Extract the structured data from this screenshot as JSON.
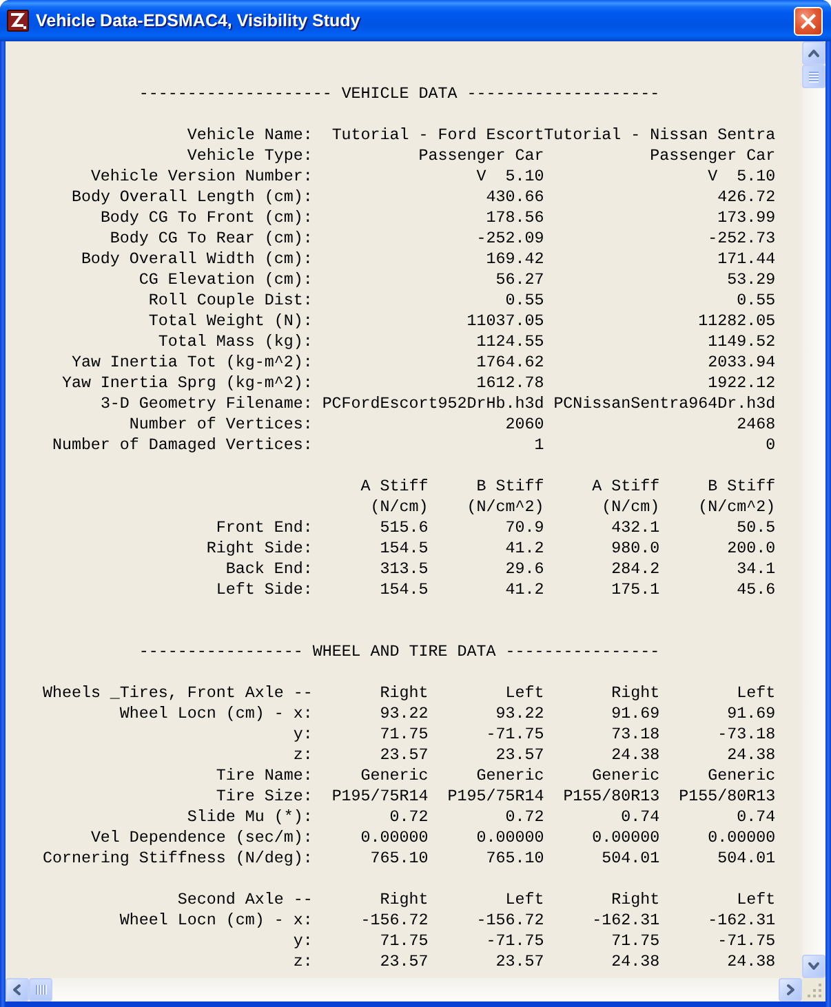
{
  "window": {
    "title": "Vehicle Data-EDSMAC4, Visibility Study"
  },
  "report": {
    "sections": [
      {
        "heading": "-------------------- VEHICLE DATA --------------------",
        "blocks": [
          {
            "kind": "pairs",
            "rows": [
              {
                "label": "Vehicle Name:",
                "values": [
                  "Tutorial - Ford Escort",
                  "Tutorial - Nissan Sentra"
                ]
              },
              {
                "label": "Vehicle Type:",
                "values": [
                  "Passenger Car",
                  "Passenger Car"
                ]
              },
              {
                "label": "Vehicle Version Number:",
                "values": [
                  "V  5.10",
                  "V  5.10"
                ]
              },
              {
                "label": "Body Overall Length (cm):",
                "values": [
                  "430.66",
                  "426.72"
                ]
              },
              {
                "label": "Body CG To Front (cm):",
                "values": [
                  "178.56",
                  "173.99"
                ]
              },
              {
                "label": "Body CG To Rear (cm):",
                "values": [
                  "-252.09",
                  "-252.73"
                ]
              },
              {
                "label": "Body Overall Width (cm):",
                "values": [
                  "169.42",
                  "171.44"
                ]
              },
              {
                "label": "CG Elevation (cm):",
                "values": [
                  "56.27",
                  "53.29"
                ]
              },
              {
                "label": "Roll Couple Dist:",
                "values": [
                  "0.55",
                  "0.55"
                ]
              },
              {
                "label": "Total Weight (N):",
                "values": [
                  "11037.05",
                  "11282.05"
                ]
              },
              {
                "label": "Total Mass (kg):",
                "values": [
                  "1124.55",
                  "1149.52"
                ]
              },
              {
                "label": "Yaw Inertia Tot (kg-m^2):",
                "values": [
                  "1764.62",
                  "2033.94"
                ]
              },
              {
                "label": "Yaw Inertia Sprg (kg-m^2):",
                "values": [
                  "1612.78",
                  "1922.12"
                ]
              },
              {
                "label": "3-D Geometry Filename:",
                "values": [
                  "PCFordEscort952DrHb.h3d",
                  "PCNissanSentra964Dr.h3d"
                ]
              },
              {
                "label": "Number of Vertices:",
                "values": [
                  "2060",
                  "2468"
                ]
              },
              {
                "label": "Number of Damaged Vertices:",
                "values": [
                  "1",
                  "0"
                ]
              }
            ]
          },
          {
            "kind": "table",
            "columns": [
              {
                "title": "A Stiff",
                "unit": "(N/cm)"
              },
              {
                "title": "B Stiff",
                "unit": "(N/cm^2)"
              },
              {
                "title": "A Stiff",
                "unit": "(N/cm)"
              },
              {
                "title": "B Stiff",
                "unit": "(N/cm^2)"
              }
            ],
            "rows": [
              {
                "label": "Front End:",
                "values": [
                  "515.6",
                  "70.9",
                  "432.1",
                  "50.5"
                ]
              },
              {
                "label": "Right Side:",
                "values": [
                  "154.5",
                  "41.2",
                  "980.0",
                  "200.0"
                ]
              },
              {
                "label": "Back End:",
                "values": [
                  "313.5",
                  "29.6",
                  "284.2",
                  "34.1"
                ]
              },
              {
                "label": "Left Side:",
                "values": [
                  "154.5",
                  "41.2",
                  "175.1",
                  "45.6"
                ]
              }
            ]
          }
        ]
      },
      {
        "heading": "----------------- WHEEL AND TIRE DATA ----------------",
        "blocks": [
          {
            "kind": "table",
            "axle_header": {
              "label": "Wheels _Tires, Front Axle --",
              "values": [
                "Right",
                "Left",
                "Right",
                "Left"
              ]
            },
            "rows": [
              {
                "label": "Wheel Locn (cm) - x:",
                "values": [
                  "93.22",
                  "93.22",
                  "91.69",
                  "91.69"
                ]
              },
              {
                "label": "y:",
                "values": [
                  "71.75",
                  "-71.75",
                  "73.18",
                  "-73.18"
                ]
              },
              {
                "label": "z:",
                "values": [
                  "23.57",
                  "23.57",
                  "24.38",
                  "24.38"
                ]
              },
              {
                "label": "Tire Name:",
                "values": [
                  "Generic",
                  "Generic",
                  "Generic",
                  "Generic"
                ]
              },
              {
                "label": "Tire Size:",
                "values": [
                  "P195/75R14",
                  "P195/75R14",
                  "P155/80R13",
                  "P155/80R13"
                ]
              },
              {
                "label": "Slide Mu (*):",
                "values": [
                  "0.72",
                  "0.72",
                  "0.74",
                  "0.74"
                ]
              },
              {
                "label": "Vel Dependence (sec/m):",
                "values": [
                  "0.00000",
                  "0.00000",
                  "0.00000",
                  "0.00000"
                ]
              },
              {
                "label": "Cornering Stiffness (N/deg):",
                "values": [
                  "765.10",
                  "765.10",
                  "504.01",
                  "504.01"
                ]
              }
            ]
          },
          {
            "kind": "table",
            "axle_header": {
              "label": "Second Axle --",
              "values": [
                "Right",
                "Left",
                "Right",
                "Left"
              ]
            },
            "rows": [
              {
                "label": "Wheel Locn (cm) - x:",
                "values": [
                  "-156.72",
                  "-156.72",
                  "-162.31",
                  "-162.31"
                ]
              },
              {
                "label": "y:",
                "values": [
                  "71.75",
                  "-71.75",
                  "71.75",
                  "-71.75"
                ]
              },
              {
                "label": "z:",
                "values": [
                  "23.57",
                  "23.57",
                  "24.38",
                  "24.38"
                ]
              }
            ]
          }
        ]
      }
    ]
  }
}
